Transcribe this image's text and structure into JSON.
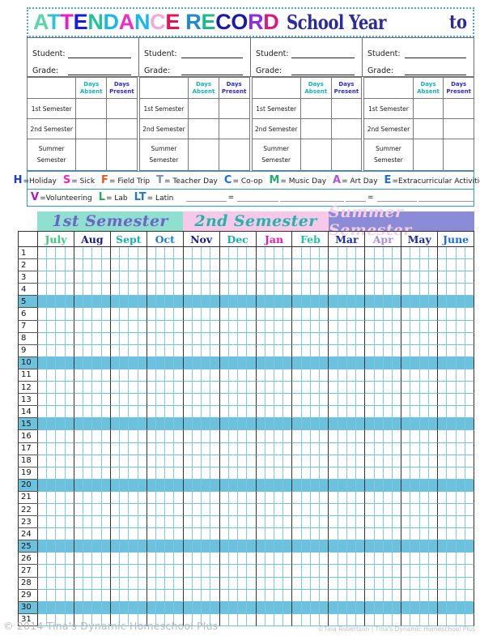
{
  "header": {
    "title_letters": [
      {
        "ch": "A",
        "color": "#5ad6a8"
      },
      {
        "ch": "T",
        "color": "#2ec4d8"
      },
      {
        "ch": "T",
        "color": "#e81ec8"
      },
      {
        "ch": "E",
        "color": "#1a1ae0"
      },
      {
        "ch": "N",
        "color": "#22c29a"
      },
      {
        "ch": "D",
        "color": "#19b8ea"
      },
      {
        "ch": "A",
        "color": "#ef2ec4"
      },
      {
        "ch": "N",
        "color": "#19b8ea"
      },
      {
        "ch": "C",
        "color": "#f3a8d8"
      },
      {
        "ch": "E",
        "color": "#e81050"
      },
      {
        "ch": " ",
        "color": "#ffffff"
      },
      {
        "ch": "R",
        "color": "#1f8ad0"
      },
      {
        "ch": "E",
        "color": "#1fb98a"
      },
      {
        "ch": "C",
        "color": "#1a1aa8"
      },
      {
        "ch": "O",
        "color": "#1a1aa8"
      },
      {
        "ch": "R",
        "color": "#8a2ee0"
      },
      {
        "ch": "D",
        "color": "#e0187a"
      }
    ],
    "school_year_label": "School Year",
    "to_label": "to"
  },
  "students": [
    {
      "student_label": "Student:",
      "student_value": "",
      "grade_label": "Grade:",
      "grade_value": ""
    },
    {
      "student_label": "Student:",
      "student_value": "",
      "grade_label": "Grade:",
      "grade_value": ""
    },
    {
      "student_label": "Student:",
      "student_value": "",
      "grade_label": "Grade:",
      "grade_value": ""
    },
    {
      "student_label": "Student:",
      "student_value": "",
      "grade_label": "Grade:",
      "grade_value": ""
    }
  ],
  "summary": {
    "col_absent": "Days Absent",
    "col_absent_l1": "Days",
    "col_absent_l2": "Absent",
    "col_present_l1": "Days",
    "col_present_l2": "Present",
    "color_absent": "#12b4b4",
    "color_present": "#2b2bd4",
    "rows": [
      {
        "label": "1st Semester",
        "absent": "",
        "present": ""
      },
      {
        "label": "2nd Semester",
        "absent": "",
        "present": ""
      },
      {
        "label": "Summer Semester",
        "absent": "",
        "present": ""
      }
    ],
    "summer_l1": "Summer",
    "summer_l2": "Semester"
  },
  "legend": {
    "line1": [
      {
        "key": "H",
        "sep": "=",
        "text": "Holiday",
        "color": "#1a3ad0",
        "small": true
      },
      {
        "key": "S",
        "sep": " = ",
        "text": "Sick",
        "color": "#ee22cc"
      },
      {
        "key": "F",
        "sep": "= ",
        "text": "Field Trip",
        "color": "#e8581a"
      },
      {
        "key": "T",
        "sep": " = ",
        "text": "Teacher Day",
        "color": "#7a8fa8"
      },
      {
        "key": "C",
        "sep": "= ",
        "text": "Co-op",
        "color": "#1a6ee0"
      },
      {
        "key": "M",
        "sep": "= ",
        "text": "Music Day",
        "color": "#1fae70"
      },
      {
        "key": "A",
        "sep": "= ",
        "text": "Art Day",
        "color": "#a855e8"
      },
      {
        "key": "E",
        "sep": "=",
        "text": "Extracurricular Activities",
        "color": "#1a6ee0"
      }
    ],
    "line2": [
      {
        "key": "V",
        "sep": "=",
        "text": "Volunteering",
        "color": "#a81ac0"
      },
      {
        "key": "L",
        "sep": " = ",
        "text": "Lab",
        "color": "#1fae52"
      },
      {
        "key": "LT",
        "sep": "= ",
        "text": "Latin",
        "color": "#1a7ae0"
      }
    ],
    "blank_equals": "="
  },
  "semester_bands": [
    {
      "label": "1st Semester",
      "bg": "#8fe0cf",
      "fg": "#6f63c9"
    },
    {
      "label": "2nd Semester",
      "bg": "#f8c8ea",
      "fg": "#1fb6a8"
    },
    {
      "label": "Summer Semester",
      "bg": "#8b8bd8",
      "fg": "#f6cde6"
    }
  ],
  "months": [
    {
      "label": "July",
      "color": "#3cc97c"
    },
    {
      "label": "Aug",
      "color": "#1a1a8c"
    },
    {
      "label": "Sept",
      "color": "#17b0b0"
    },
    {
      "label": "Oct",
      "color": "#1a7ed0"
    },
    {
      "label": "Nov",
      "color": "#1a1a9c"
    },
    {
      "label": "Dec",
      "color": "#17b0ae"
    },
    {
      "label": "Jan",
      "color": "#ee1aaa"
    },
    {
      "label": "Feb",
      "color": "#1fc4a0"
    },
    {
      "label": "Mar",
      "color": "#1a2ea0"
    },
    {
      "label": "Apr",
      "color": "#a98fe0"
    },
    {
      "label": "May",
      "color": "#1a2ea0"
    },
    {
      "label": "June",
      "color": "#1a6ed8"
    }
  ],
  "grid": {
    "row_numbers": [
      1,
      2,
      3,
      4,
      5,
      6,
      7,
      8,
      9,
      10,
      11,
      12,
      13,
      14,
      15,
      16,
      17,
      18,
      19,
      20,
      21,
      22,
      23,
      24,
      25,
      26,
      27,
      28,
      29,
      30,
      31
    ],
    "highlight_every": 5,
    "highlight_color": "#6cc2dd",
    "subcolumns_per_month": 4
  },
  "footer": {
    "left": "© 2014 Tina's Dynamic Homeschool Plus",
    "right": "©Tina Robertson | Tina's Dynamic Homeschool Plus"
  }
}
